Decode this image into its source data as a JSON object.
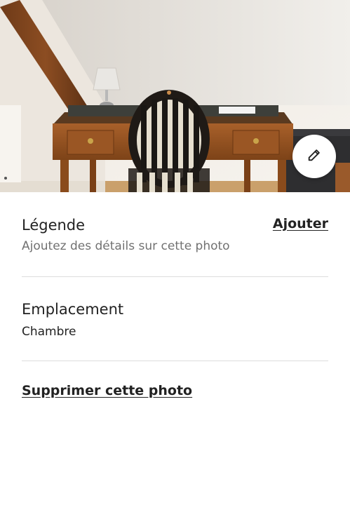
{
  "photo": {
    "alt": "Bureau en bois avec chaise à dossier rayé",
    "edit_icon": "pencil-icon"
  },
  "caption": {
    "title": "Légende",
    "action_label": "Ajouter",
    "placeholder": "Ajoutez des détails sur cette photo"
  },
  "location": {
    "title": "Emplacement",
    "value": "Chambre"
  },
  "delete": {
    "label": "Supprimer cette photo"
  },
  "colors": {
    "text_primary": "#222222",
    "text_secondary": "#717171",
    "divider": "#dddddd"
  }
}
